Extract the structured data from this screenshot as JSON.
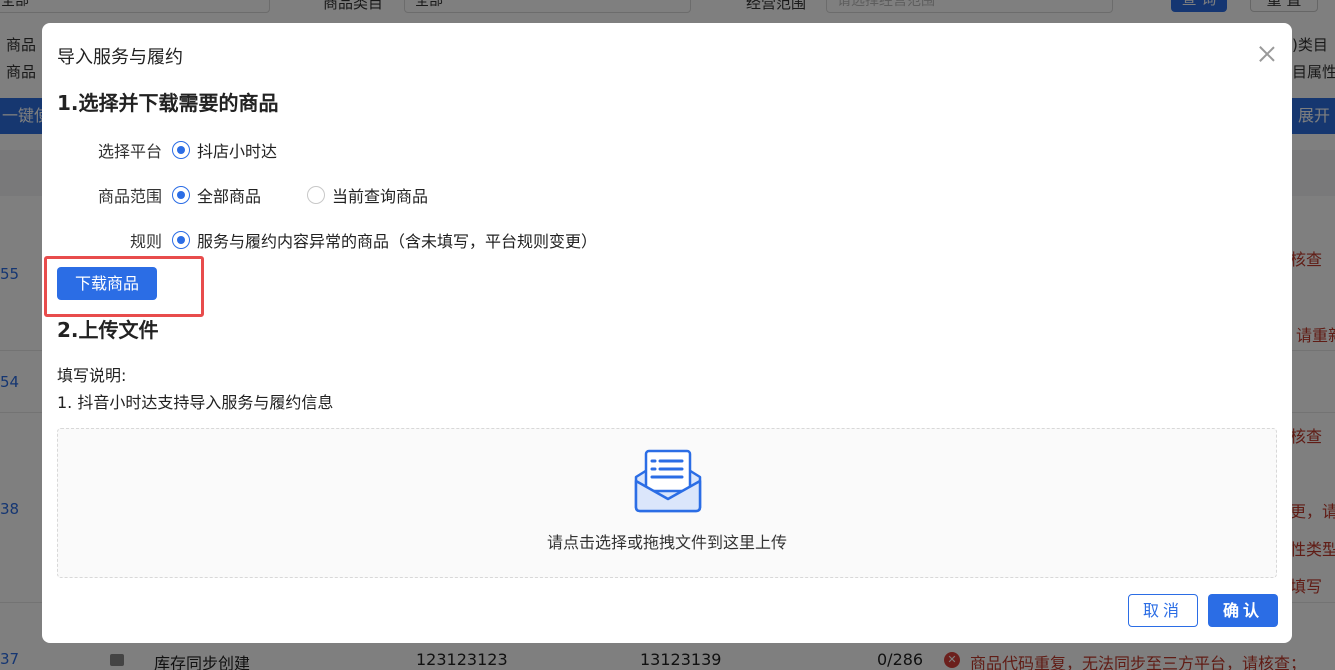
{
  "background": {
    "filters": {
      "field1_value": "全部",
      "category_label": "商品类目",
      "category_value": "全部",
      "scope_label": "经营范围",
      "scope_placeholder": "请选择经营范围",
      "query_button": "查 询",
      "reset_button": "重 置"
    },
    "left_lines": [
      "商品",
      "商品"
    ],
    "right_lines": [
      ")类目",
      "目属性"
    ],
    "toolbar_left": "一键使",
    "toolbar_right": "展开",
    "row_ids": [
      "55",
      "54",
      "38",
      "37"
    ],
    "right_msgs": [
      "核查",
      "请重新",
      "核查",
      "更，请",
      "性类型",
      "填写"
    ],
    "last_row": {
      "name": "库存同步创建",
      "code1": "123123123",
      "code2": "13123139",
      "stock": "0/286",
      "error": "商品代码重复，无法同步至三方平台，请核查；"
    }
  },
  "modal": {
    "title": "导入服务与履约",
    "section1_title": "1.选择并下载需要的商品",
    "platform_label": "选择平台",
    "platform_option": "抖店小时达",
    "range_label": "商品范围",
    "range_options": [
      "全部商品",
      "当前查询商品"
    ],
    "rule_label": "规则",
    "rule_option": "服务与履约内容异常的商品（含未填写，平台规则变更）",
    "download_button": "下载商品",
    "section2_title": "2.上传文件",
    "instructions_title": "填写说明:",
    "instructions_item": "1. 抖音小时达支持导入服务与履约信息",
    "upload_text": "请点击选择或拖拽文件到这里上传",
    "cancel_button": "取消",
    "confirm_button": "确认"
  },
  "colors": {
    "primary": "#2b6de5",
    "highlight": "#e84c4c",
    "error": "#c0392b"
  }
}
